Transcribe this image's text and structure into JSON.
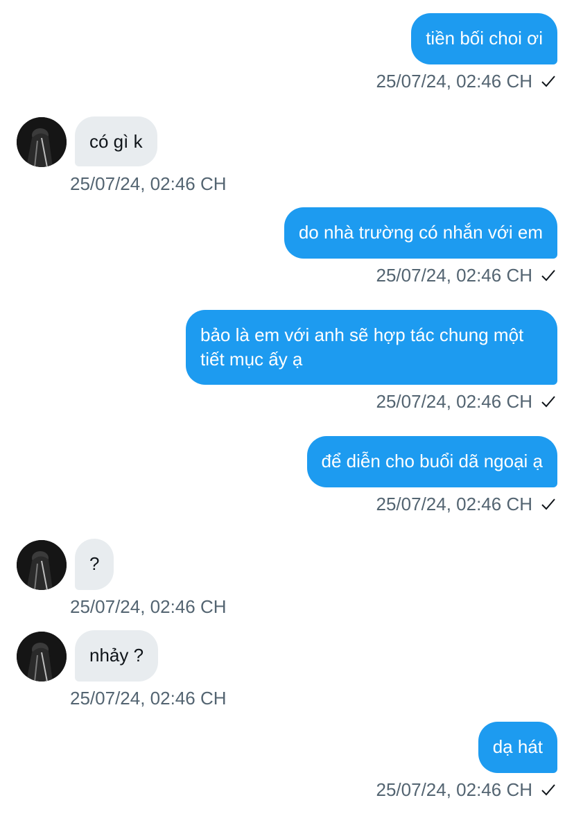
{
  "messages": [
    {
      "dir": "out",
      "text": "tiền bối choi ơi",
      "time": "25/07/24, 02:46 CH"
    },
    {
      "dir": "in",
      "text": "có gì k",
      "time": "25/07/24, 02:46 CH"
    },
    {
      "dir": "out",
      "text": "do nhà trường có nhắn với em",
      "time": "25/07/24, 02:46 CH"
    },
    {
      "dir": "out",
      "text": "bảo là em với anh sẽ hợp tác chung một tiết mục ấy ạ",
      "time": "25/07/24, 02:46 CH"
    },
    {
      "dir": "out",
      "text": "để diễn cho buổi dã ngoại ạ",
      "time": "25/07/24, 02:46 CH"
    },
    {
      "dir": "in",
      "text": "?",
      "time": "25/07/24, 02:46 CH"
    },
    {
      "dir": "in",
      "text": "nhảy ?",
      "time": "25/07/24, 02:46 CH"
    },
    {
      "dir": "out",
      "text": "dạ hát",
      "time": "25/07/24, 02:46 CH"
    }
  ],
  "icons": {
    "read_receipt": "checkmark-icon",
    "avatar": "avatar"
  },
  "colors": {
    "outgoing_bubble": "#1d9bf0",
    "incoming_bubble": "#e8ecef",
    "timestamp": "#536471"
  }
}
